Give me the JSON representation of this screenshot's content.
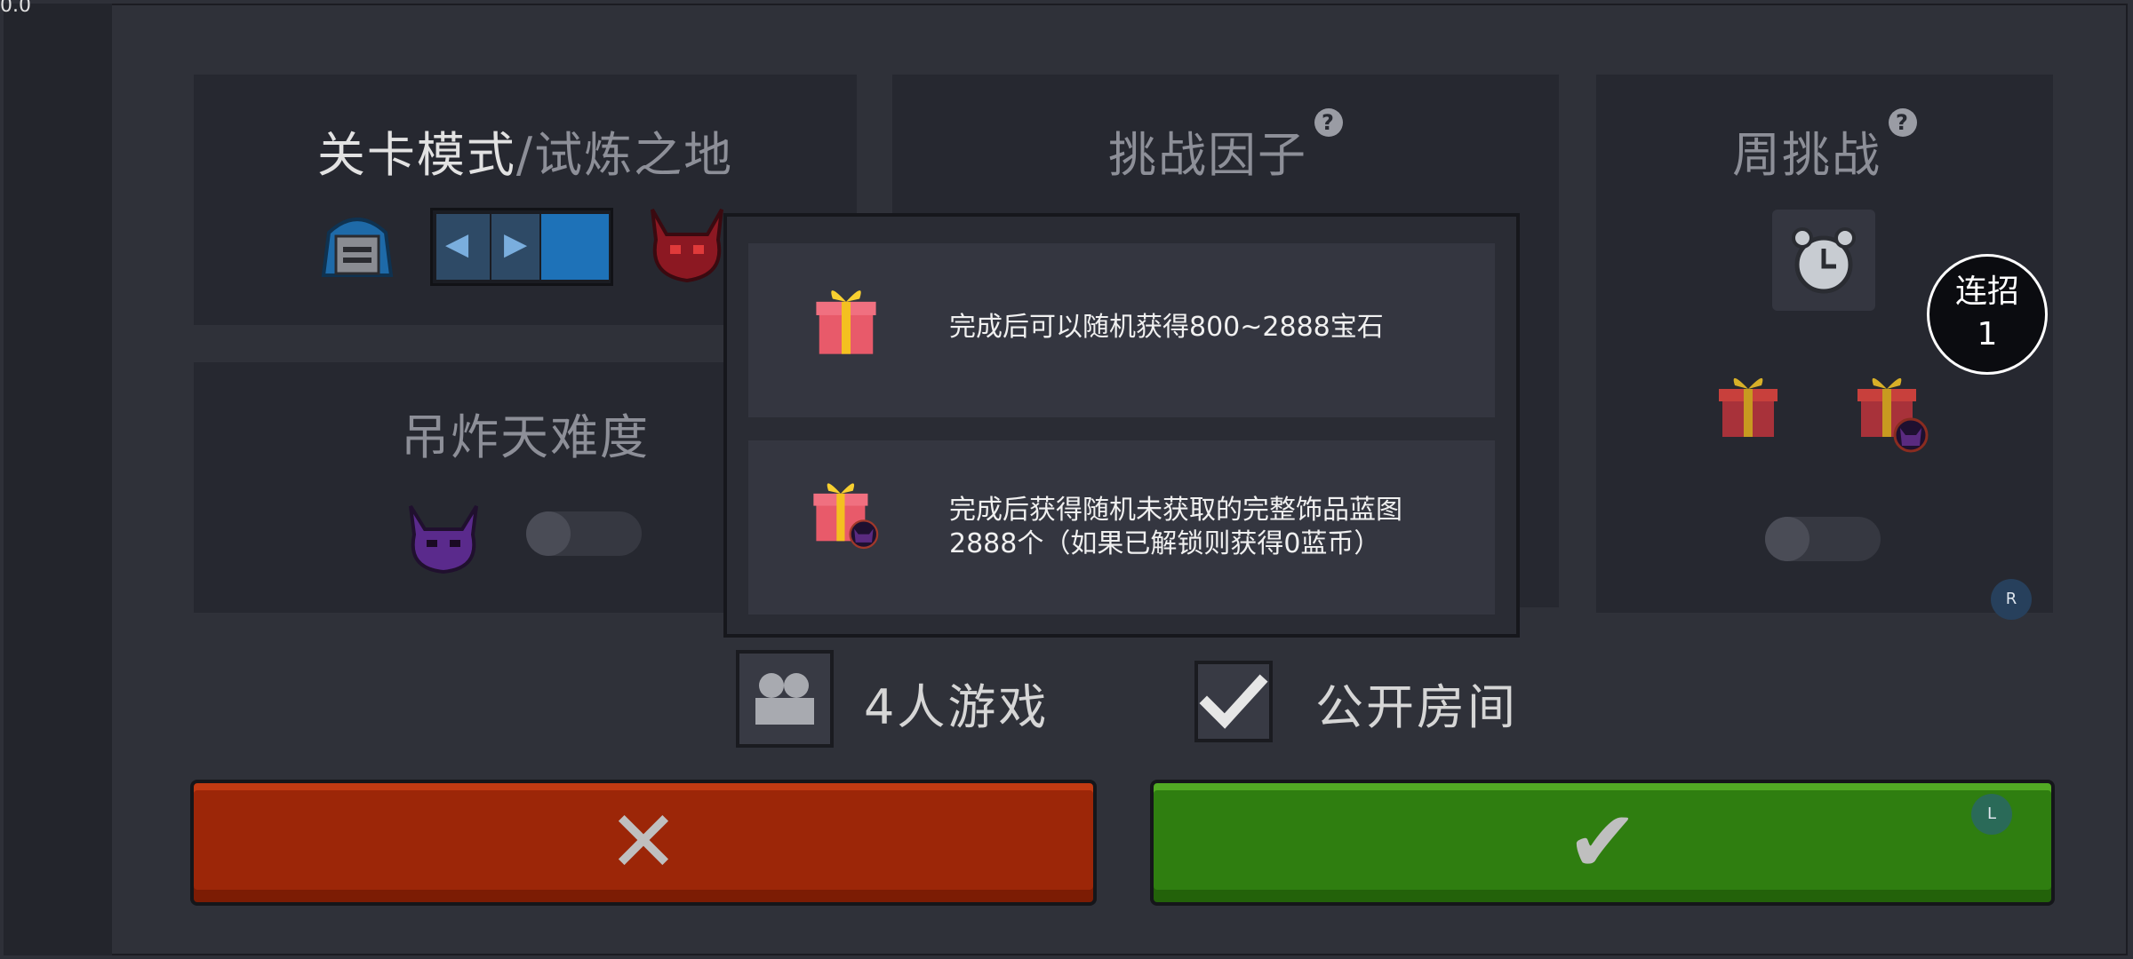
{
  "version": "0.0",
  "level_panel": {
    "title_main": "关卡模式",
    "title_sep": "/",
    "title_sub": "试炼之地"
  },
  "challenge_panel": {
    "title": "挑战因子",
    "help": "?"
  },
  "weekly_panel": {
    "title": "周挑战",
    "help": "?"
  },
  "difficulty_panel": {
    "title": "吊炸天难度"
  },
  "modal": {
    "rewards": [
      {
        "icon": "gift-icon",
        "text": "完成后可以随机获得800~2888宝石"
      },
      {
        "icon": "gift-blueprint-icon",
        "text": "完成后获得随机未获取的完整饰品蓝图2888个（如果已解锁则获得0蓝币）"
      }
    ]
  },
  "players": {
    "label": "4人游戏",
    "icon": "players-icon"
  },
  "public_room": {
    "label": "公开房间",
    "checked": true
  },
  "buttons": {
    "cancel_glyph": "✕",
    "confirm_glyph": "✔"
  },
  "combo": {
    "label": "连招",
    "count": "1"
  },
  "badges": {
    "right": "R",
    "left": "L"
  },
  "colors": {
    "cancel": "#9c2608",
    "confirm": "#2f7e10",
    "toggle_blue": "#1e72b8"
  }
}
